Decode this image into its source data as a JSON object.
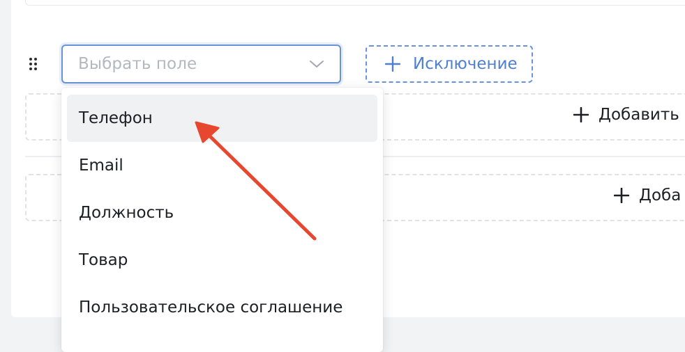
{
  "select": {
    "placeholder": "Выбрать поле",
    "icon": "chevron-down-icon"
  },
  "exclusion_button": {
    "label": "Исключение",
    "icon": "plus-icon",
    "color": "#4f7fd1"
  },
  "add_buttons": [
    {
      "label": "Добавить",
      "icon": "plus-icon"
    },
    {
      "label": "Доба",
      "icon": "plus-icon"
    }
  ],
  "dropdown": {
    "options": [
      {
        "label": "Телефон",
        "highlighted": true
      },
      {
        "label": "Email"
      },
      {
        "label": "Должность"
      },
      {
        "label": "Товар"
      },
      {
        "label": "Пользовательское соглашение"
      }
    ]
  },
  "annotation": {
    "icon": "arrow-icon",
    "color": "#e8472f"
  },
  "colors": {
    "accent": "#6a92d6",
    "background": "#f2f3f5",
    "option_hover": "#f0f1f3"
  }
}
